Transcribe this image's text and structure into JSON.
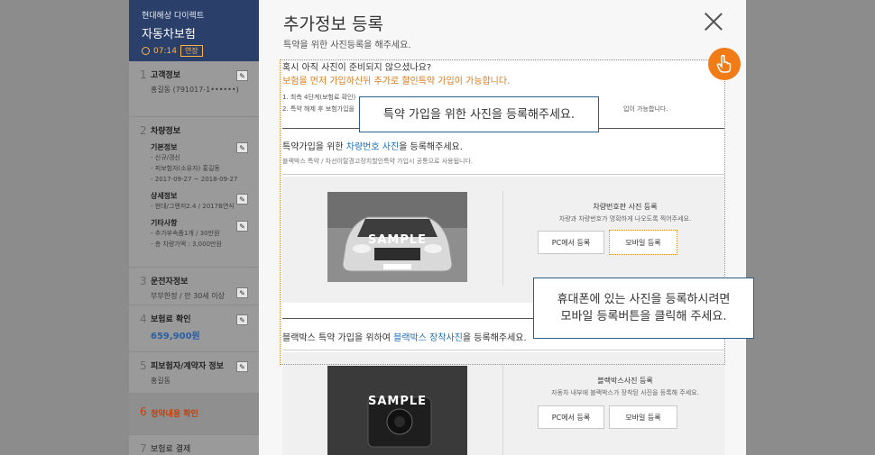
{
  "sidebar": {
    "brand": "현대해상 다이렉트",
    "title": "자동차보험",
    "timer": "07:14",
    "extend_label": "연장",
    "sections": [
      {
        "num": "1",
        "label": "고객정보",
        "sub": "홍길동 (791017-1••••••)"
      },
      {
        "num": "2",
        "label": "차량정보",
        "groups": [
          {
            "title": "기본정보",
            "items": [
              "- 신규/갱신",
              "- 피보험자(소유자) 홍길동",
              "- 2017-09-27 ~ 2018-09-27"
            ]
          },
          {
            "title": "상세정보",
            "items": [
              "- 현대/그랜저2.4 / 2017B연식"
            ]
          },
          {
            "title": "기타사항",
            "items": [
              "- 추가부속품1개 / 30만원",
              "- 총 차량가액 : 3,000만원"
            ]
          }
        ]
      },
      {
        "num": "3",
        "label": "운전자정보",
        "sub": "부부한정 / 만 30세 이상"
      },
      {
        "num": "4",
        "label": "보험료 확인",
        "price": "659,900원"
      },
      {
        "num": "5",
        "label": "피보험자/계약자 정보",
        "sub": "홍길동"
      },
      {
        "num": "6",
        "label": "청약내용 확인"
      },
      {
        "num": "7",
        "label": "보험료 결제"
      }
    ]
  },
  "modal": {
    "title": "추가정보 등록",
    "subtitle": "특약을 위한 사진등록을 해주세요.",
    "notice_question": "혹시 아직 사진이 준비되지 않으셨나요?",
    "notice_emphasis": "보험을 먼저 가입하신뒤 추가로 할인특약 가입이 가능합니다.",
    "notice_items": [
      "1. 최측 4단계(보험료 확인)",
      "2. 특약 해제 후 보험가입을",
      "입이 가능합니다."
    ],
    "section1": {
      "title_pre": "특약가입을 위한 ",
      "title_hl": "차량번호 사진",
      "title_post": "을 등록해주세요.",
      "desc": "블랙박스 특약 / 차선이탈경고장치할인특약 가입시 공통으로 사용됩니다.",
      "sample_label": "SAMPLE",
      "reg_title": "차량번호판 사진 등록",
      "reg_desc": "차량과 차량번호가 명확하게 나오도록 찍어주세요.",
      "pc_button": "PC에서 등록",
      "mobile_button": "모바일 등록"
    },
    "section2": {
      "title_pre": "블랙박스 특약 가입을 위하여 ",
      "title_hl": "블랙박스 장착사진",
      "title_post": "을 등록해주세요.",
      "sample_label": "SAMPLE",
      "reg_title": "블랙박스사진 등록",
      "reg_desc": "자동차 내부에 블랙박스가 장착된 사진을 등록해 주세요.",
      "pc_button": "PC에서 등록",
      "mobile_button": "모바일 등록"
    }
  },
  "tooltips": {
    "top": "특약 가입을 위한 사진을 등록해주세요.",
    "bottom_line1": "휴대폰에 있는 사진을 등록하시려면",
    "bottom_line2": "모바일 등록버튼을 클릭해 주세요."
  },
  "colors": {
    "accent": "#e0861f",
    "highlight_text": "#1e6fbf",
    "sidebar_head": "#2a3f6a",
    "tooltip_border": "#2a5f8a"
  }
}
